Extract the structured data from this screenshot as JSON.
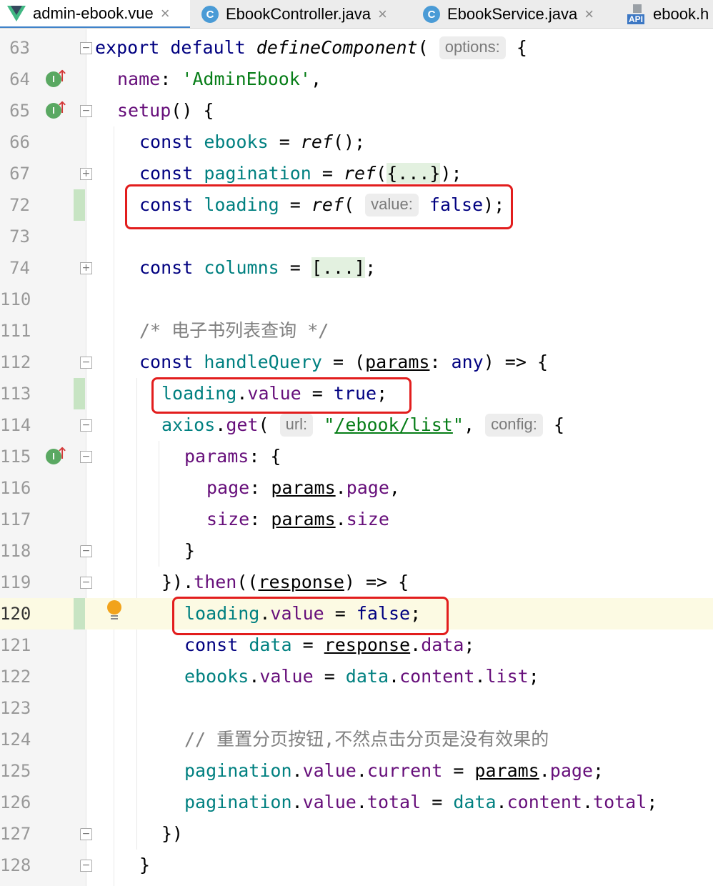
{
  "tabs": [
    {
      "label": "admin-ebook.vue",
      "icon": "vue-icon",
      "active": true
    },
    {
      "label": "EbookController.java",
      "icon": "java-class-icon",
      "active": false
    },
    {
      "label": "EbookService.java",
      "icon": "java-class-icon",
      "active": false
    },
    {
      "label": "ebook.h",
      "icon": "api-icon",
      "active": false
    }
  ],
  "tab_close_glyph": "×",
  "class_icon_letter": "C",
  "api_icon_text": "API",
  "impl_icon_letter": "I",
  "colors": {
    "keyword": "#000080",
    "property": "#660e7a",
    "variable": "#008080",
    "string": "#067d17",
    "comment": "#808080",
    "highlight_box": "#e21d1d",
    "vcs_changed": "#c7e4c3",
    "caret_line": "#fcfae3"
  },
  "editor": {
    "caret_line_number": "120",
    "lines": [
      {
        "num": "63"
      },
      {
        "num": "64"
      },
      {
        "num": "65"
      },
      {
        "num": "66"
      },
      {
        "num": "67"
      },
      {
        "num": "72"
      },
      {
        "num": "73"
      },
      {
        "num": "74"
      },
      {
        "num": "110"
      },
      {
        "num": "111"
      },
      {
        "num": "112"
      },
      {
        "num": "113"
      },
      {
        "num": "114"
      },
      {
        "num": "115"
      },
      {
        "num": "116"
      },
      {
        "num": "117"
      },
      {
        "num": "118"
      },
      {
        "num": "119"
      },
      {
        "num": "120"
      },
      {
        "num": "121"
      },
      {
        "num": "122"
      },
      {
        "num": "123"
      },
      {
        "num": "124"
      },
      {
        "num": "125"
      },
      {
        "num": "126"
      },
      {
        "num": "127"
      },
      {
        "num": "128"
      }
    ],
    "hints": {
      "options": "options:",
      "value": "value:",
      "url": "url:",
      "config": "config:"
    },
    "tokens": {
      "export": "export",
      "default": "default",
      "defineComponent": "defineComponent",
      "paren_open": "(",
      "brace_open": " {",
      "name": "name",
      "colon": ": ",
      "admin_str": "'AdminEbook'",
      "comma": ",",
      "setup": "setup",
      "setup_rest": "() {",
      "const": "const",
      "ebooks": "ebooks",
      "eq": " = ",
      "ref": "ref",
      "call_end": "();",
      "pagination": "pagination",
      "folded_obj": "{...}",
      "close_call": ");",
      "loading": "loading",
      "false": "false",
      "true": "true",
      "columns": "columns",
      "folded_arr": "[...]",
      "semi": ";",
      "comment_list": "/* 电子书列表查询 */",
      "handleQuery": "handleQuery",
      "arrow_head": " = (",
      "params": "params",
      "any": "any",
      "arrow_tail": ") => {",
      "dot": ".",
      "value": "value",
      "axios": "axios",
      "get": "get",
      "url_str": "\"/ebook/list\"",
      "url_quote_open": "\"",
      "url_path": "/ebook/list",
      "url_quote_close": "\"",
      "params_key": "params",
      "brace": "{",
      "page": "page",
      "size": "size",
      "close_brace": "}",
      "then_head": "}).",
      "then": "then",
      "then_open": "((",
      "response": "response",
      "then_tail": ") => {",
      "data": "data",
      "content": "content",
      "list": "list",
      "comment_reset": "// 重置分页按钮,不然点击分页是没有效果的",
      "current": "current",
      "total": "total",
      "close_paren_brace": "})"
    }
  }
}
